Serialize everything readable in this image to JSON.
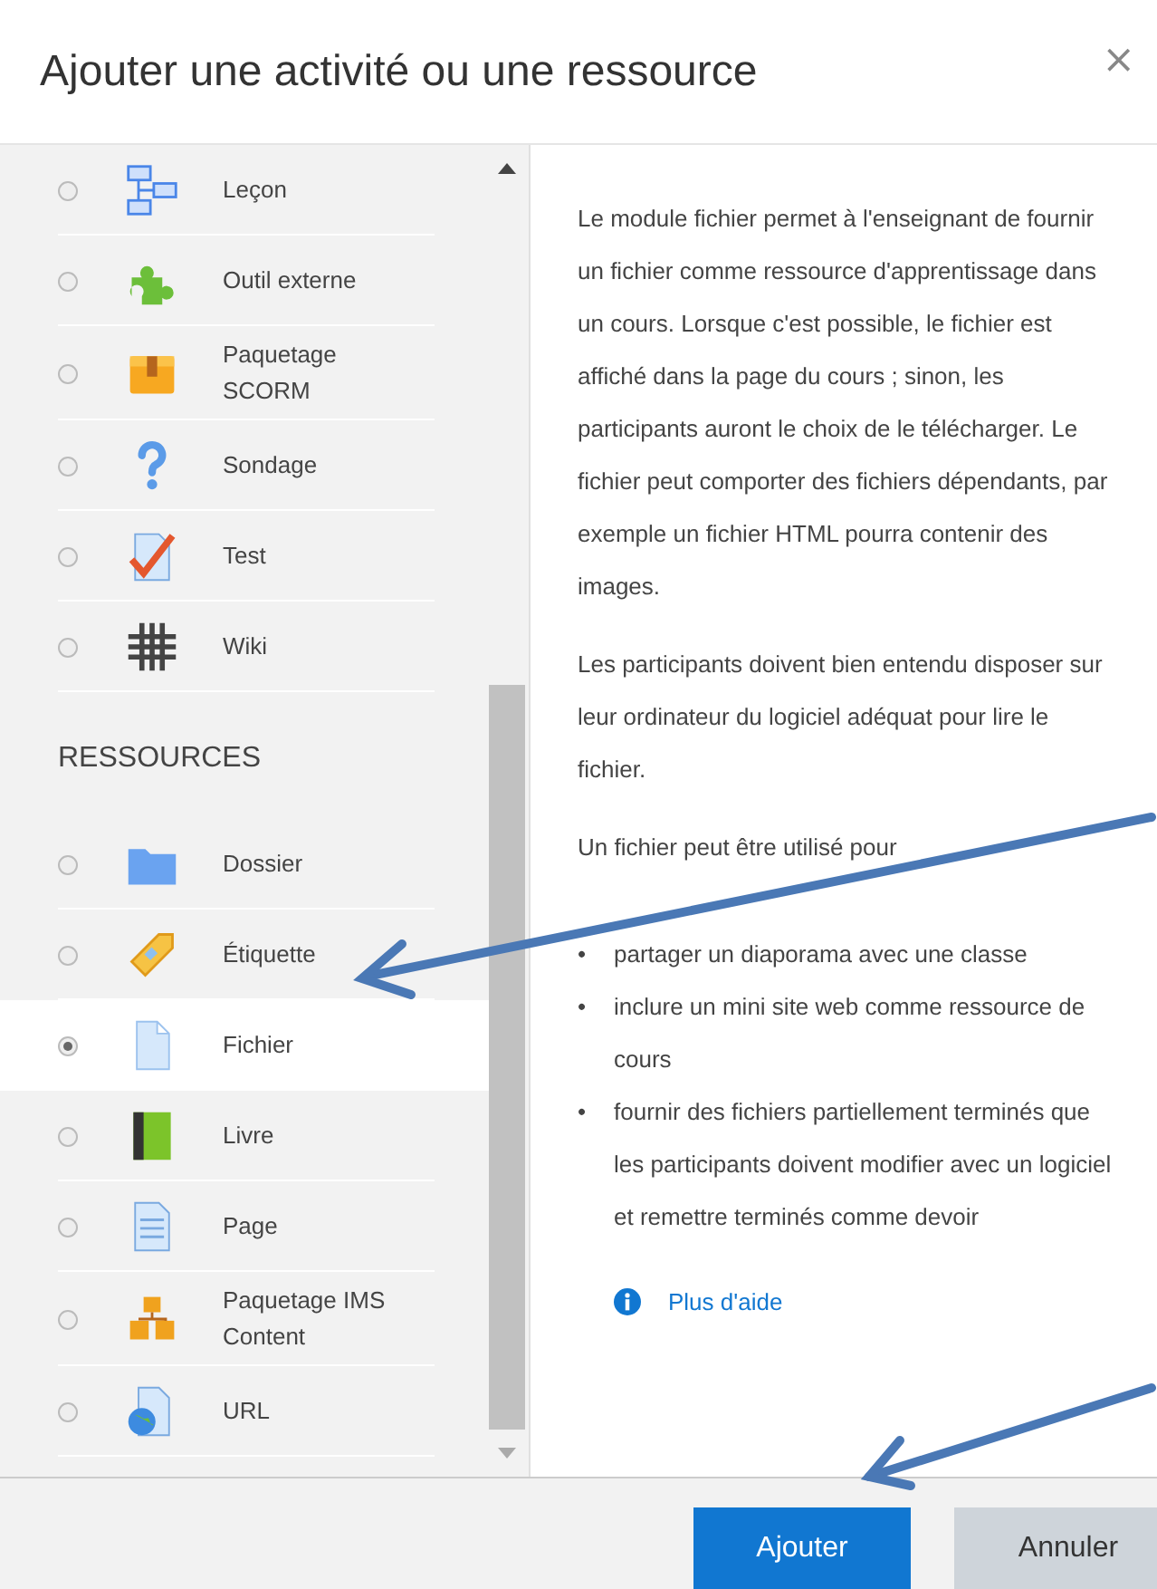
{
  "dialog": {
    "title": "Ajouter une activité ou une ressource",
    "close": "×"
  },
  "sidebar": {
    "groups": [
      {
        "items": [
          {
            "label": "Leçon",
            "kind": "lesson",
            "selected": false
          },
          {
            "label": "Outil externe",
            "kind": "puzzle",
            "selected": false
          },
          {
            "label": "Paquetage SCORM",
            "kind": "box",
            "selected": false
          },
          {
            "label": "Sondage",
            "kind": "question",
            "selected": false
          },
          {
            "label": "Test",
            "kind": "check",
            "selected": false
          },
          {
            "label": "Wiki",
            "kind": "wiki",
            "selected": false
          }
        ]
      },
      {
        "heading": "RESSOURCES",
        "items": [
          {
            "label": "Dossier",
            "kind": "folder",
            "selected": false
          },
          {
            "label": "Étiquette",
            "kind": "tag",
            "selected": false
          },
          {
            "label": "Fichier",
            "kind": "file",
            "selected": true
          },
          {
            "label": "Livre",
            "kind": "book",
            "selected": false
          },
          {
            "label": "Page",
            "kind": "page",
            "selected": false
          },
          {
            "label": "Paquetage IMS Content",
            "kind": "boxes",
            "selected": false
          },
          {
            "label": "URL",
            "kind": "globe",
            "selected": false
          }
        ]
      }
    ]
  },
  "description": {
    "paragraphs": [
      "Le module fichier permet à l'enseignant de fournir un fichier comme ressource d'apprentissage dans un cours. Lorsque c'est possible, le fichier est affiché dans la page du cours ; sinon, les participants auront le choix de le télécharger. Le fichier peut comporter des fichiers dépendants, par exemple un fichier HTML pourra contenir des images.",
      "Les participants doivent bien entendu disposer sur leur ordinateur du logiciel adéquat pour lire le fichier.",
      "Un fichier peut être utilisé pour"
    ],
    "bullet_marker": "•",
    "bullets": [
      "partager un diaporama avec une classe",
      "inclure un mini site web comme ressource de cours",
      "fournir des fichiers partiellement terminés que les participants doivent modifier avec un logiciel et remettre terminés comme devoir"
    ],
    "help_link": "Plus d'aide"
  },
  "footer": {
    "buttons": [
      {
        "label": "Ajouter",
        "kind": "primary"
      },
      {
        "label": "Annuler",
        "kind": "secondary"
      }
    ]
  }
}
